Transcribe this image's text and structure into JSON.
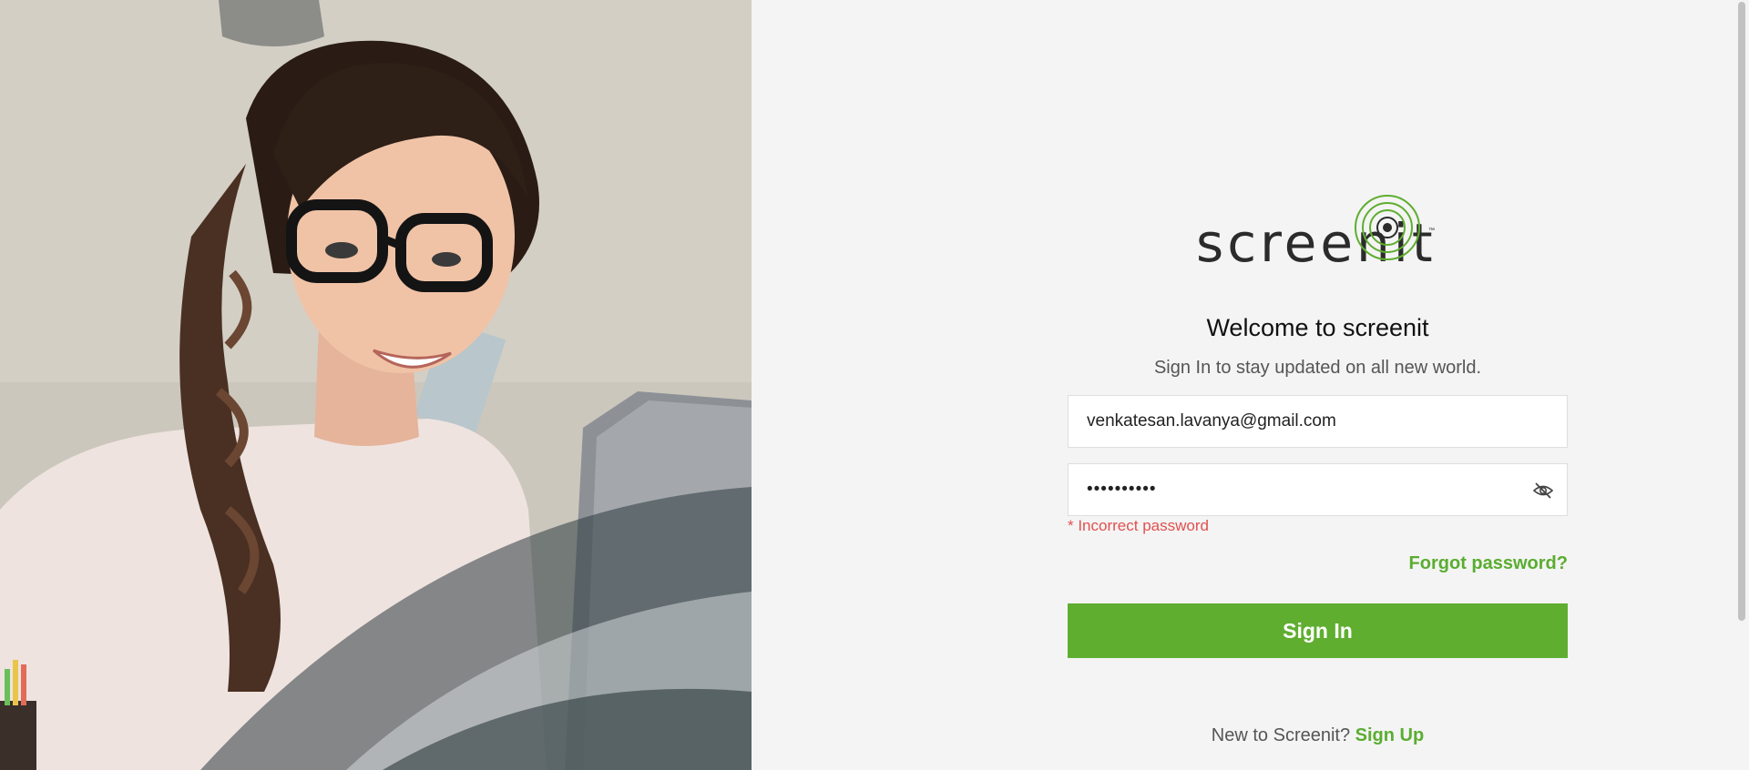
{
  "brand": {
    "logo_text": "screenit",
    "trademark": "™",
    "logo_icon": "concentric-rings-icon",
    "accent_color": "#5fae30"
  },
  "hero": {
    "image": "woman-with-glasses-smiling-at-laptop"
  },
  "login": {
    "title": "Welcome to screenit",
    "subtitle": "Sign In to stay updated on all new world.",
    "email_value": "venkatesan.lavanya@gmail.com",
    "password_value": "••••••••••",
    "password_toggle_icon": "eye-off-icon",
    "error": "* Incorrect password",
    "forgot_label": "Forgot password?",
    "submit_label": "Sign In",
    "footer_prompt": "New to Screenit?",
    "signup_label": "Sign Up",
    "error_color": "#e0514f"
  }
}
